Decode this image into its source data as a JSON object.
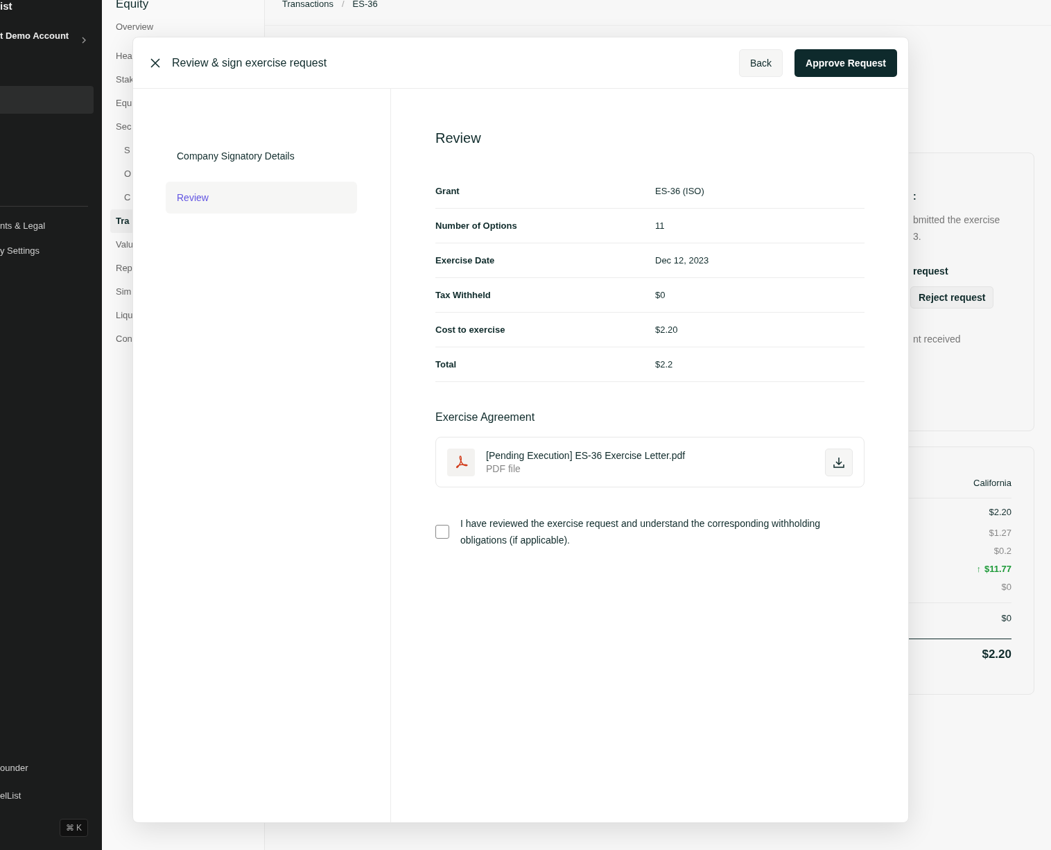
{
  "sidebar": {
    "title": "ist",
    "account": "t Demo Account",
    "highlighted_row": {
      "selected": true
    },
    "items": [
      {
        "label": "nts & Legal"
      },
      {
        "label": "y Settings"
      }
    ],
    "bottom_items": [
      {
        "label": "ounder"
      },
      {
        "label": "elList"
      }
    ],
    "shortcut": "⌘ K"
  },
  "section_nav": {
    "title": "Equity",
    "items": [
      {
        "label": "Overview",
        "selected": false
      },
      {
        "label": "Hea",
        "selected": false
      },
      {
        "label": "Stak",
        "selected": false
      },
      {
        "label": "Equ",
        "selected": false
      },
      {
        "label": "Sec",
        "selected": false,
        "children": [
          {
            "label": "S",
            "selected": false
          },
          {
            "label": "O",
            "selected": false
          },
          {
            "label": "C",
            "selected": false
          }
        ]
      },
      {
        "label": "Tra",
        "selected": true
      },
      {
        "label": "Valu",
        "selected": false
      },
      {
        "label": "Rep",
        "selected": false
      },
      {
        "label": "Sim",
        "selected": false
      },
      {
        "label": "Liqu",
        "selected": false
      },
      {
        "label": "Con",
        "selected": false
      }
    ]
  },
  "breadcrumb": [
    "Transactions",
    "ES-36"
  ],
  "breadcrumb_separator": "/",
  "request_card": {
    "heading": ":",
    "lines": [
      "bmitted the exercise",
      "3."
    ],
    "subheading": "request",
    "button": "Reject request",
    "note": "nt received"
  },
  "summary_card": {
    "column": "California",
    "rows": [
      {
        "value": "$2.20",
        "kind": "strong"
      },
      {
        "value": "$1.27",
        "kind": "muted"
      },
      {
        "value": "$0.2",
        "kind": "muted"
      },
      {
        "value": "$11.77",
        "kind": "increase",
        "arrow": "↑"
      },
      {
        "value": "$0",
        "kind": "muted"
      }
    ],
    "subtotal": "$0",
    "total": "$2.20"
  },
  "modal": {
    "title": "Review & sign exercise request",
    "back_button": "Back",
    "approve_button": "Approve Request",
    "steps": [
      {
        "label": "Company Signatory Details",
        "selected": false
      },
      {
        "label": "Review",
        "selected": true
      }
    ],
    "heading": "Review",
    "details": [
      {
        "label": "Grant",
        "value": "ES-36 (ISO)"
      },
      {
        "label": "Number of Options",
        "value": "11"
      },
      {
        "label": "Exercise Date",
        "value": "Dec 12, 2023"
      },
      {
        "label": "Tax Withheld",
        "value": "$0"
      },
      {
        "label": "Cost to exercise",
        "value": "$2.20"
      },
      {
        "label": "Total",
        "value": "$2.2"
      }
    ],
    "agreement_heading": "Exercise Agreement",
    "file": {
      "name": "[Pending Execution] ES-36 Exercise Letter.pdf",
      "type": "PDF file"
    },
    "acknowledgement": {
      "checked": false,
      "label": "I have reviewed the exercise request and understand the corresponding withholding obligations (if applicable)."
    }
  }
}
